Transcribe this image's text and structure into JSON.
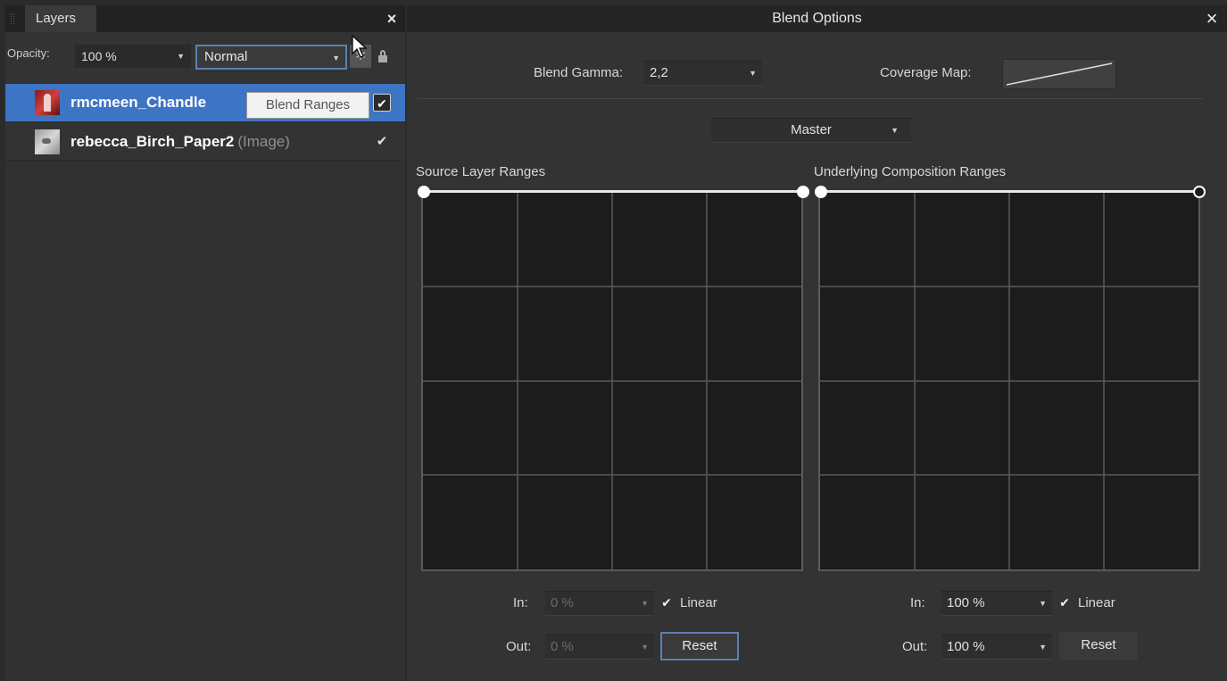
{
  "layers_panel": {
    "tab_label": "Layers",
    "close_glyph": "×",
    "opacity_label": "Opacity:",
    "opacity_value": "100 %",
    "blend_mode": "Normal",
    "gear_glyph": "✲",
    "tooltip": "Blend Ranges",
    "layers": [
      {
        "name": "rmcmeen_Chandle",
        "type": "",
        "visible": true,
        "selected": true
      },
      {
        "name": "rebecca_Birch_Paper2",
        "type": "(Image)",
        "visible": true,
        "selected": false
      }
    ],
    "check_glyph": "✔"
  },
  "blend_options": {
    "title": "Blend Options",
    "close_glyph": "×",
    "blend_gamma_label": "Blend Gamma:",
    "blend_gamma_value": "2,2",
    "coverage_map_label": "Coverage Map:",
    "channel": "Master",
    "source": {
      "title": "Source Layer Ranges",
      "in_label": "In:",
      "in_value": "0 %",
      "out_label": "Out:",
      "out_value": "0 %",
      "linear_label": "Linear",
      "linear_checked": true,
      "reset_label": "Reset"
    },
    "underlying": {
      "title": "Underlying Composition Ranges",
      "in_label": "In:",
      "in_value": "100 %",
      "out_label": "Out:",
      "out_value": "100 %",
      "linear_label": "Linear",
      "linear_checked": true,
      "reset_label": "Reset"
    }
  },
  "dropdown_glyph": "▼",
  "colors": {
    "selection": "#3e74c4",
    "focus_border": "#5a82b4",
    "graph_bg": "#1c1c1c",
    "grid_line": "#5a5a5a"
  }
}
